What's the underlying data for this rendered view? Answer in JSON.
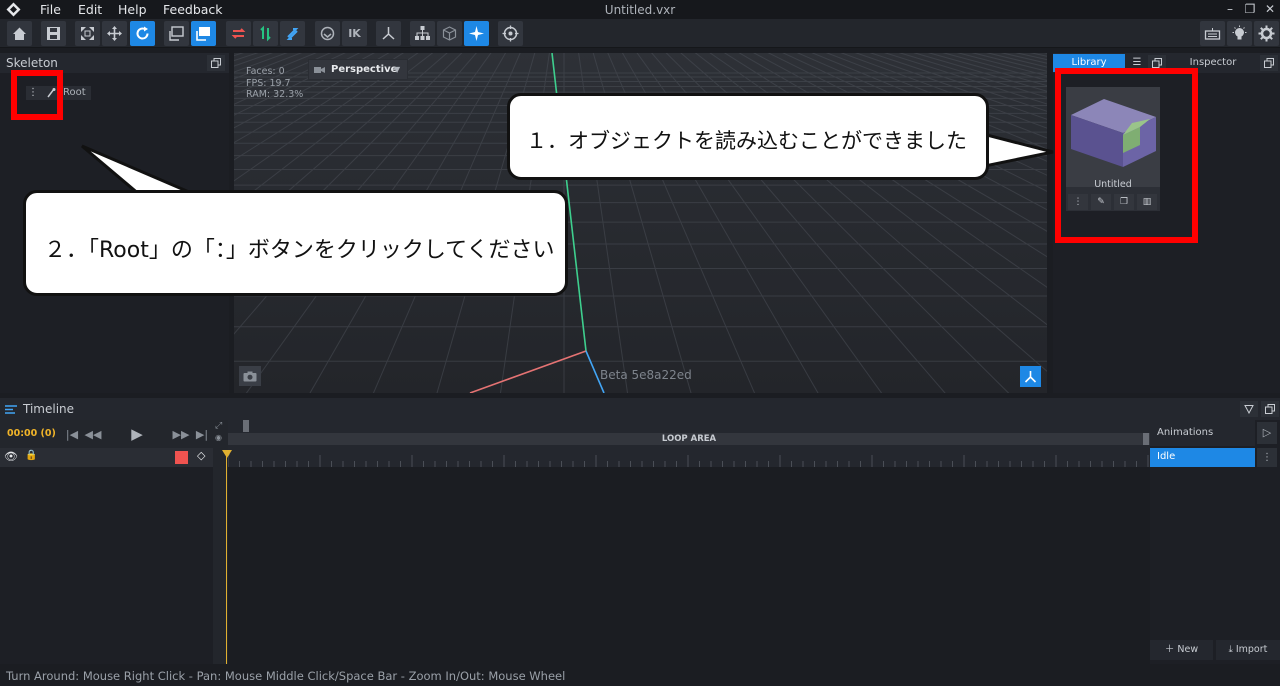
{
  "window": {
    "title": "Untitled.vxr"
  },
  "menu": {
    "items": [
      "File",
      "Edit",
      "Help",
      "Feedback"
    ]
  },
  "toolbar": {
    "tools": [
      {
        "icon": "home-icon"
      },
      {
        "icon": "save-icon"
      },
      {
        "icon": "scale-icon"
      },
      {
        "icon": "move-icon"
      },
      {
        "icon": "rotate-icon"
      },
      {
        "icon": "pivot-icon"
      },
      {
        "icon": "pivot-active-icon"
      },
      {
        "icon": "swap-red-icon"
      },
      {
        "icon": "swap-green-icon"
      },
      {
        "icon": "swap-blue-icon"
      },
      {
        "icon": "rig-icon"
      },
      {
        "icon": "ik-label"
      },
      {
        "icon": "axes-icon"
      },
      {
        "icon": "hierarchy-icon"
      },
      {
        "icon": "cube-icon"
      },
      {
        "icon": "sparkle-icon"
      },
      {
        "icon": "target-icon"
      }
    ],
    "ik_label": "IK"
  },
  "skeleton": {
    "title": "Skeleton",
    "root_label": "Root",
    "menu_glyph": "⋮"
  },
  "viewport": {
    "stats": {
      "faces": "Faces: 0",
      "fps": "FPS: 19.7",
      "ram": "RAM: 32.3%"
    },
    "camera_mode": "Perspective",
    "version": "Beta 5e8a22ed"
  },
  "right_panel": {
    "tabs": [
      "Library",
      "Inspector"
    ],
    "active_tab": "Library",
    "item_name": "Untitled"
  },
  "timeline": {
    "title": "Timeline",
    "time": "00:00 (0)",
    "loop_label": "LOOP AREA",
    "frame0": "0",
    "animations_title": "Animations",
    "animations": [
      "Idle"
    ],
    "new_label": "New",
    "import_label": "Import"
  },
  "status": {
    "hint": "Turn Around: Mouse Right Click - Pan: Mouse Middle Click/Space Bar - Zoom In/Out: Mouse Wheel"
  },
  "overlay": {
    "callout1": "１．オブジェクトを読み込むことができました",
    "callout2": "２．「Root」の「：」ボタンをクリックしてください",
    "highlight_color": "#ff0000"
  },
  "colors": {
    "accent": "#1e88e5",
    "playhead": "#e0b030",
    "time": "#f0b429"
  }
}
